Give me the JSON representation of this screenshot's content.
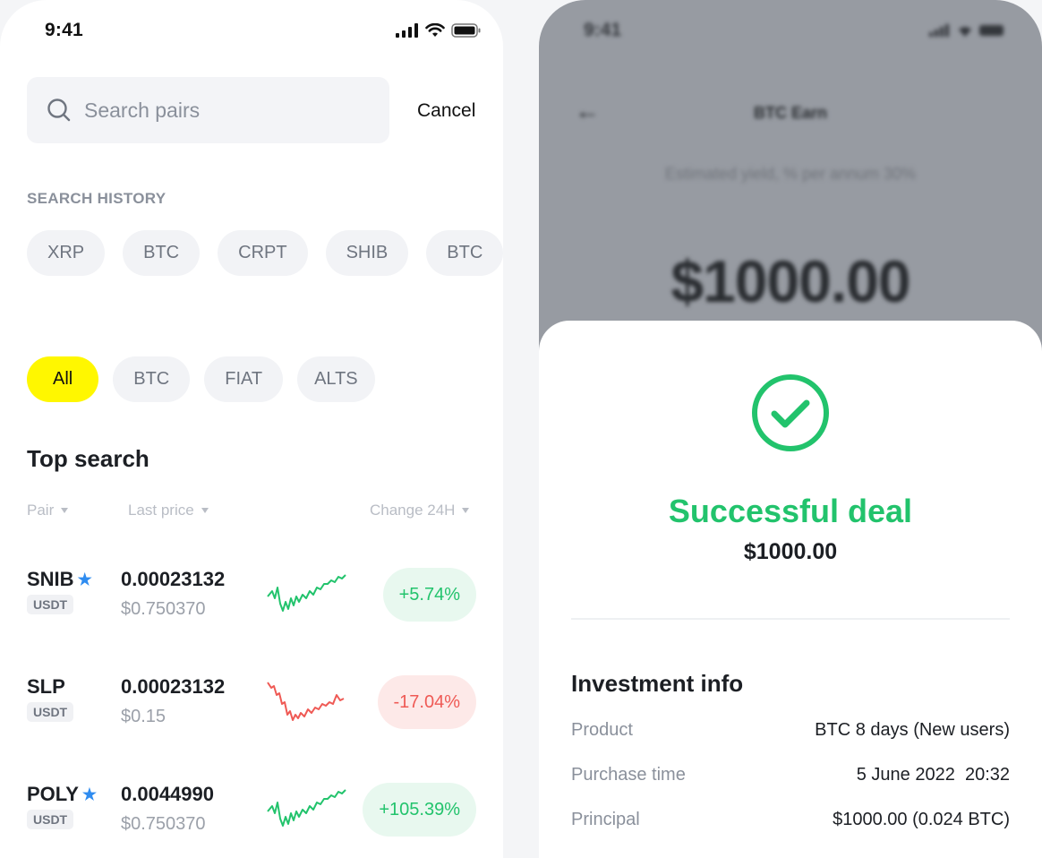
{
  "left": {
    "status_time": "9:41",
    "search": {
      "placeholder": "Search pairs",
      "cancel_label": "Cancel"
    },
    "history_label": "SEARCH HISTORY",
    "history": [
      "XRP",
      "BTC",
      "CRPT",
      "SHIB",
      "BTC"
    ],
    "filters": {
      "all": "All",
      "btc": "BTC",
      "fiat": "FIAT",
      "alts": "ALTS"
    },
    "active_filter": "All",
    "accent_color": "#fff700",
    "top_title": "Top search",
    "columns": {
      "pair": "Pair",
      "last_price": "Last price",
      "change": "Change 24H"
    },
    "rows": [
      {
        "symbol": "SNIB",
        "starred": true,
        "quote": "USDT",
        "price": "0.00023132",
        "usd": "$0.750370",
        "change": "+5.74%",
        "trend": "up",
        "spark_icon": "sparkline-up"
      },
      {
        "symbol": "SLP",
        "starred": false,
        "quote": "USDT",
        "price": "0.00023132",
        "usd": "$0.15",
        "change": "-17.04%",
        "trend": "down",
        "spark_icon": "sparkline-down"
      },
      {
        "symbol": "POLY",
        "starred": true,
        "quote": "USDT",
        "price": "0.0044990",
        "usd": "$0.750370",
        "change": "+105.39%",
        "trend": "up",
        "spark_icon": "sparkline-up"
      }
    ],
    "colors": {
      "up": "#22c36c",
      "down": "#ef5a55",
      "star": "#2f8cf0"
    }
  },
  "right": {
    "status_time": "9:41",
    "title": "BTC Earn",
    "yield_text": "Estimated yield, % per annum 30%",
    "background_amount": "$1000.00",
    "success_title": "Successful deal",
    "success_amount": "$1000.00",
    "info_title": "Investment info",
    "info": [
      {
        "label": "Product",
        "value": "BTC 8 days (New users)"
      },
      {
        "label": "Purchase time",
        "value": "5 June 2022  20:32"
      },
      {
        "label": "Principal",
        "value": "$1000.00 (0.024 BTC)"
      }
    ],
    "success_color": "#22c36c"
  }
}
